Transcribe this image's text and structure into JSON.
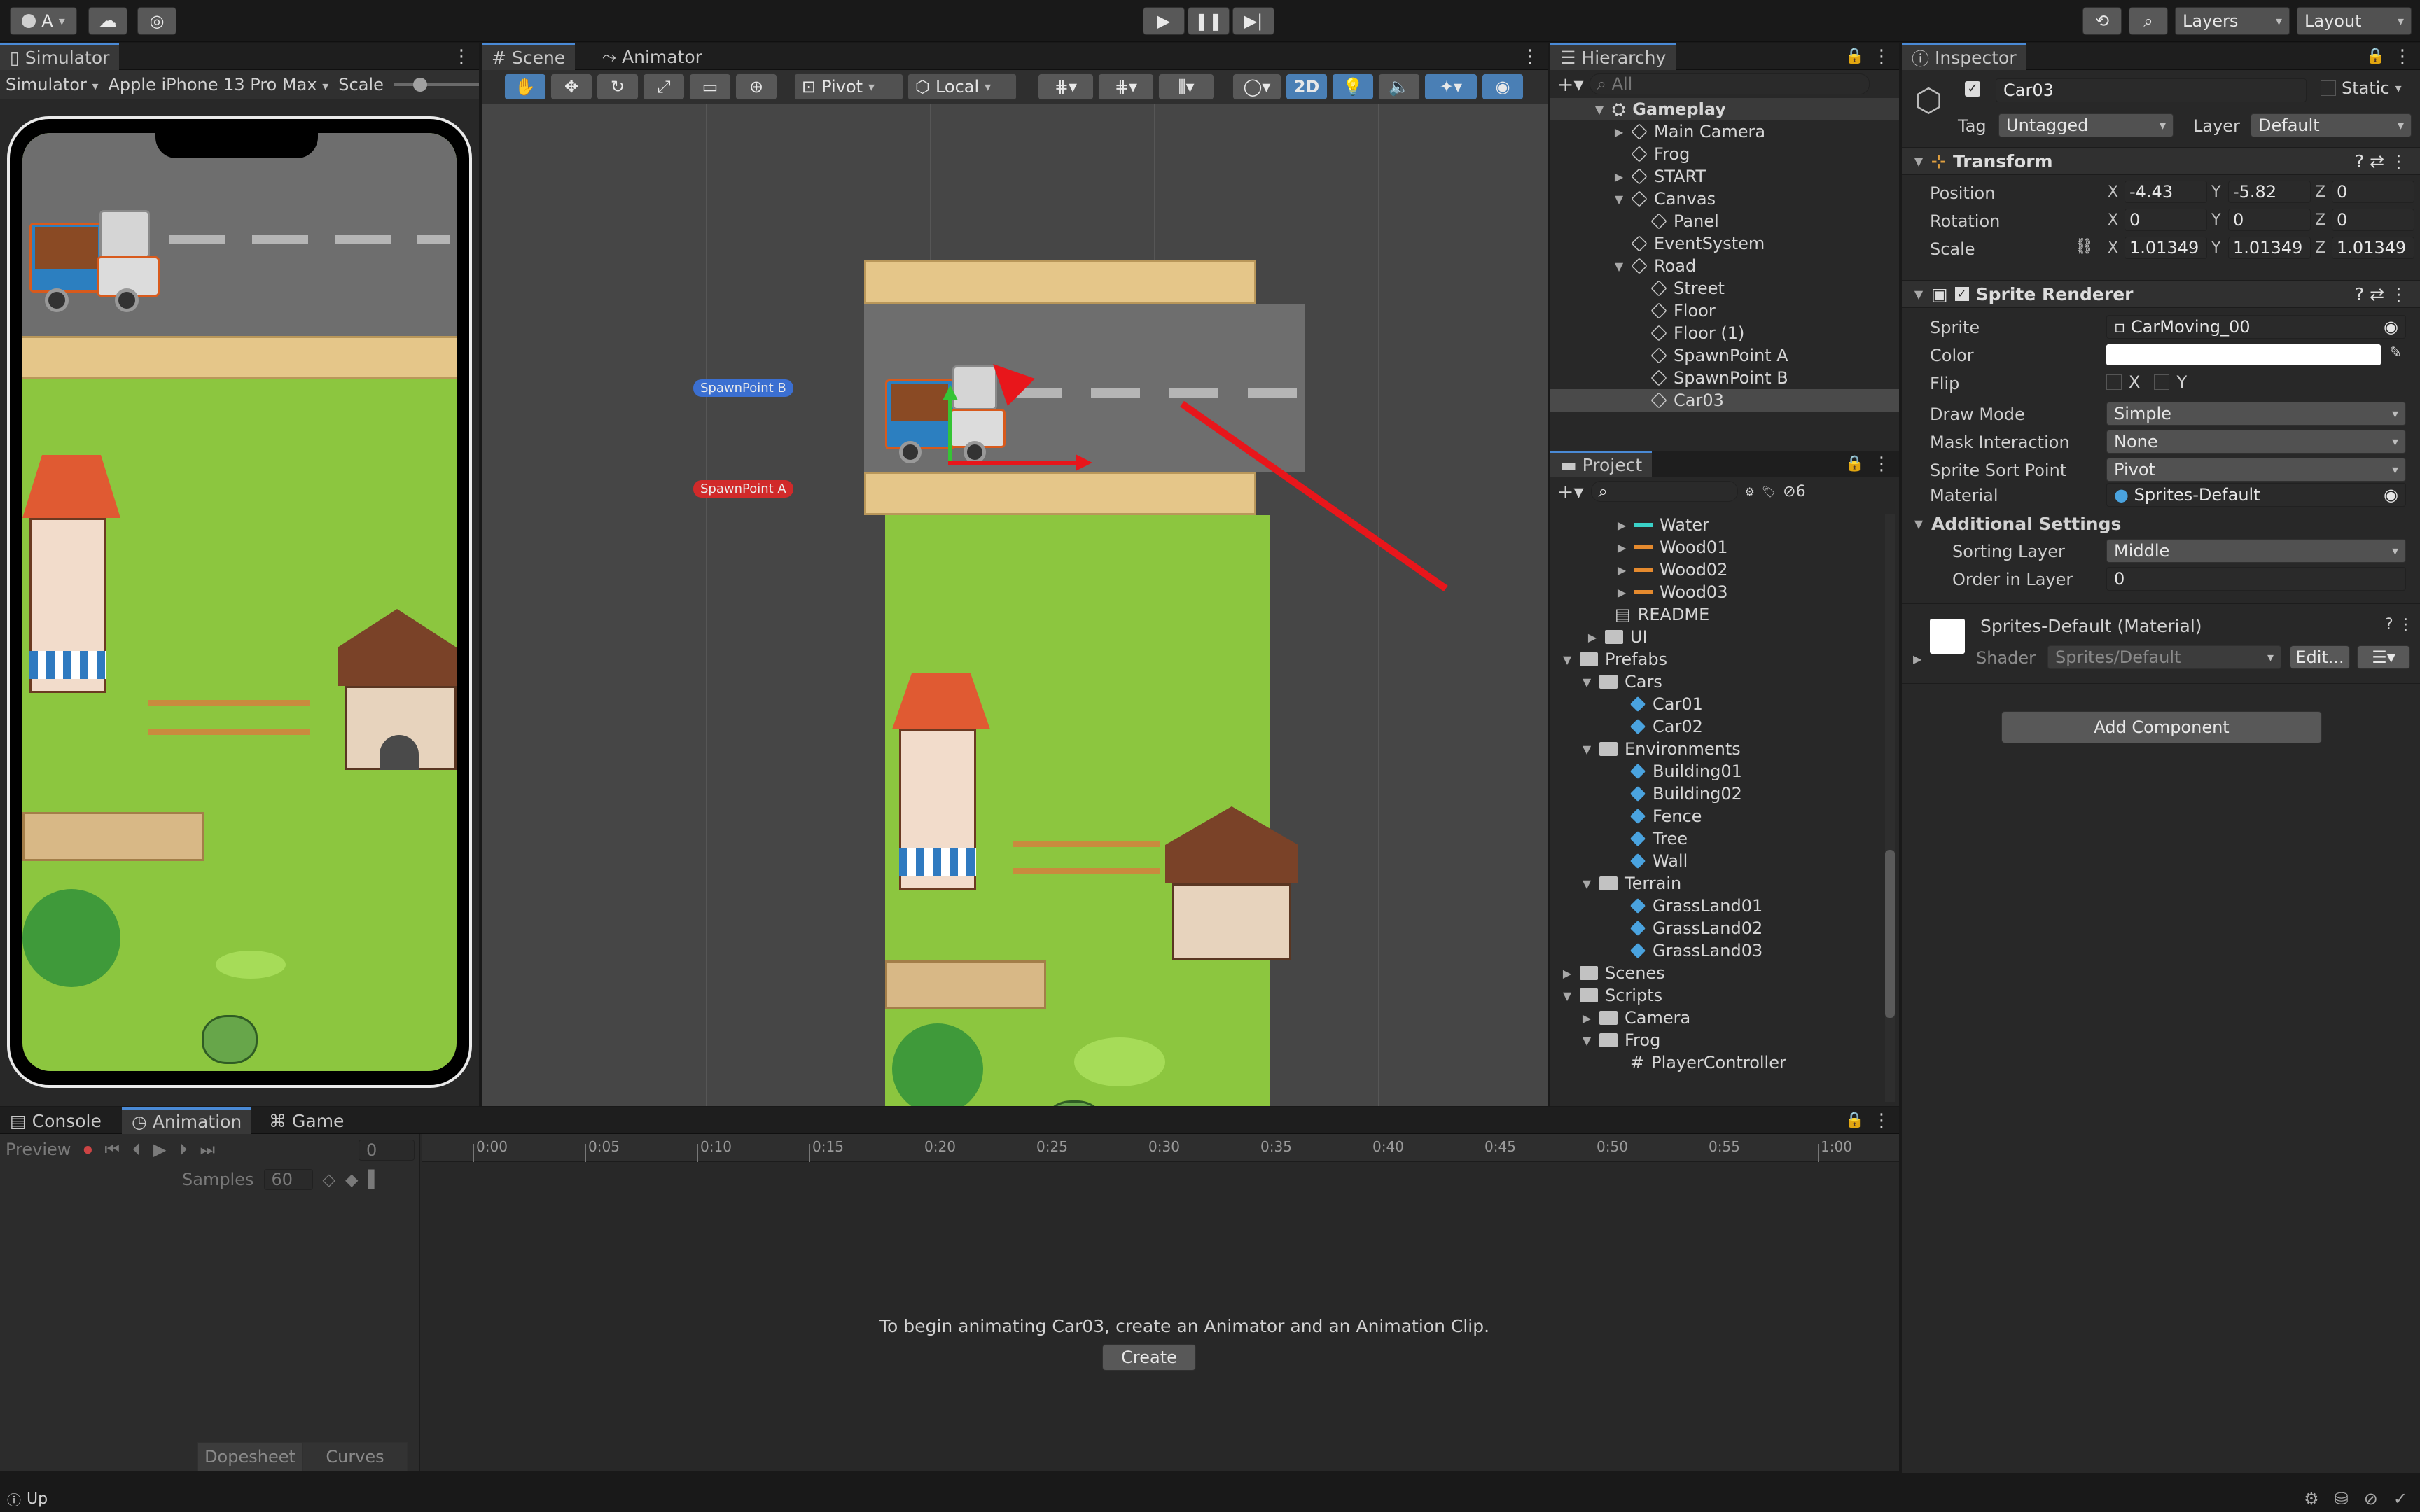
{
  "toolbar": {
    "account": "A",
    "layers": "Layers",
    "layout": "Layout"
  },
  "simulator": {
    "tab": "Simulator",
    "mode": "Simulator",
    "device": "Apple iPhone 13 Pro Max",
    "scale_label": "Scale"
  },
  "scene": {
    "tab_scene": "Scene",
    "tab_animator": "Animator",
    "pivot": "Pivot",
    "local": "Local",
    "mode_2d": "2D",
    "spawn_b": "SpawnPoint B",
    "spawn_a": "SpawnPoint A"
  },
  "hierarchy": {
    "tab": "Hierarchy",
    "search_placeholder": "All",
    "root": "Gameplay",
    "items": [
      "Main Camera",
      "Frog",
      "START",
      "Canvas",
      "Panel",
      "EventSystem",
      "Road",
      "Street",
      "Floor",
      "Floor (1)",
      "SpawnPoint A",
      "SpawnPoint B",
      "Car03"
    ]
  },
  "project": {
    "tab": "Project",
    "badge": "6",
    "items": [
      "Water",
      "Wood01",
      "Wood02",
      "Wood03",
      "README",
      "UI",
      "Prefabs",
      "Cars",
      "Car01",
      "Car02",
      "Environments",
      "Building01",
      "Building02",
      "Fence",
      "Tree",
      "Wall",
      "Terrain",
      "GrassLand01",
      "GrassLand02",
      "GrassLand03",
      "Scenes",
      "Scripts",
      "Camera",
      "Frog",
      "PlayerController"
    ]
  },
  "inspector": {
    "tab": "Inspector",
    "object_name": "Car03",
    "static_label": "Static",
    "tag_label": "Tag",
    "tag_value": "Untagged",
    "layer_label": "Layer",
    "layer_value": "Default",
    "transform": {
      "title": "Transform",
      "position": "Position",
      "rotation": "Rotation",
      "scale": "Scale",
      "pos": [
        "-4.43",
        "-5.82",
        "0"
      ],
      "rot": [
        "0",
        "0",
        "0"
      ],
      "scl": [
        "1.01349",
        "1.01349",
        "1.01349"
      ]
    },
    "sprite_renderer": {
      "title": "Sprite Renderer",
      "sprite_label": "Sprite",
      "sprite_value": "CarMoving_00",
      "color_label": "Color",
      "flip_label": "Flip",
      "flip_x": "X",
      "flip_y": "Y",
      "draw_mode_label": "Draw Mode",
      "draw_mode": "Simple",
      "mask_label": "Mask Interaction",
      "mask": "None",
      "sort_point_label": "Sprite Sort Point",
      "sort_point": "Pivot",
      "material_label": "Material",
      "material": "Sprites-Default",
      "additional": "Additional Settings",
      "sorting_layer_label": "Sorting Layer",
      "sorting_layer": "Middle",
      "order_label": "Order in Layer",
      "order": "0"
    },
    "material": {
      "name": "Sprites-Default (Material)",
      "shader_label": "Shader",
      "shader": "Sprites/Default",
      "edit": "Edit..."
    },
    "add_component": "Add Component"
  },
  "bottom": {
    "tab_console": "Console",
    "tab_animation": "Animation",
    "tab_game": "Game",
    "preview": "Preview",
    "frame": "0",
    "samples_label": "Samples",
    "samples": "60",
    "ticks": [
      "0:00",
      "0:05",
      "0:10",
      "0:15",
      "0:20",
      "0:25",
      "0:30",
      "0:35",
      "0:40",
      "0:45",
      "0:50",
      "0:55",
      "1:00"
    ],
    "message": "To begin animating Car03, create an Animator and an Animation Clip.",
    "create": "Create",
    "dopesheet": "Dopesheet",
    "curves": "Curves"
  },
  "status": {
    "text": "Up"
  },
  "colors": {
    "accent": "#4a8ad6",
    "grass": "#8cc63f",
    "road": "#6e6e6e",
    "arrow": "#e8161b"
  }
}
